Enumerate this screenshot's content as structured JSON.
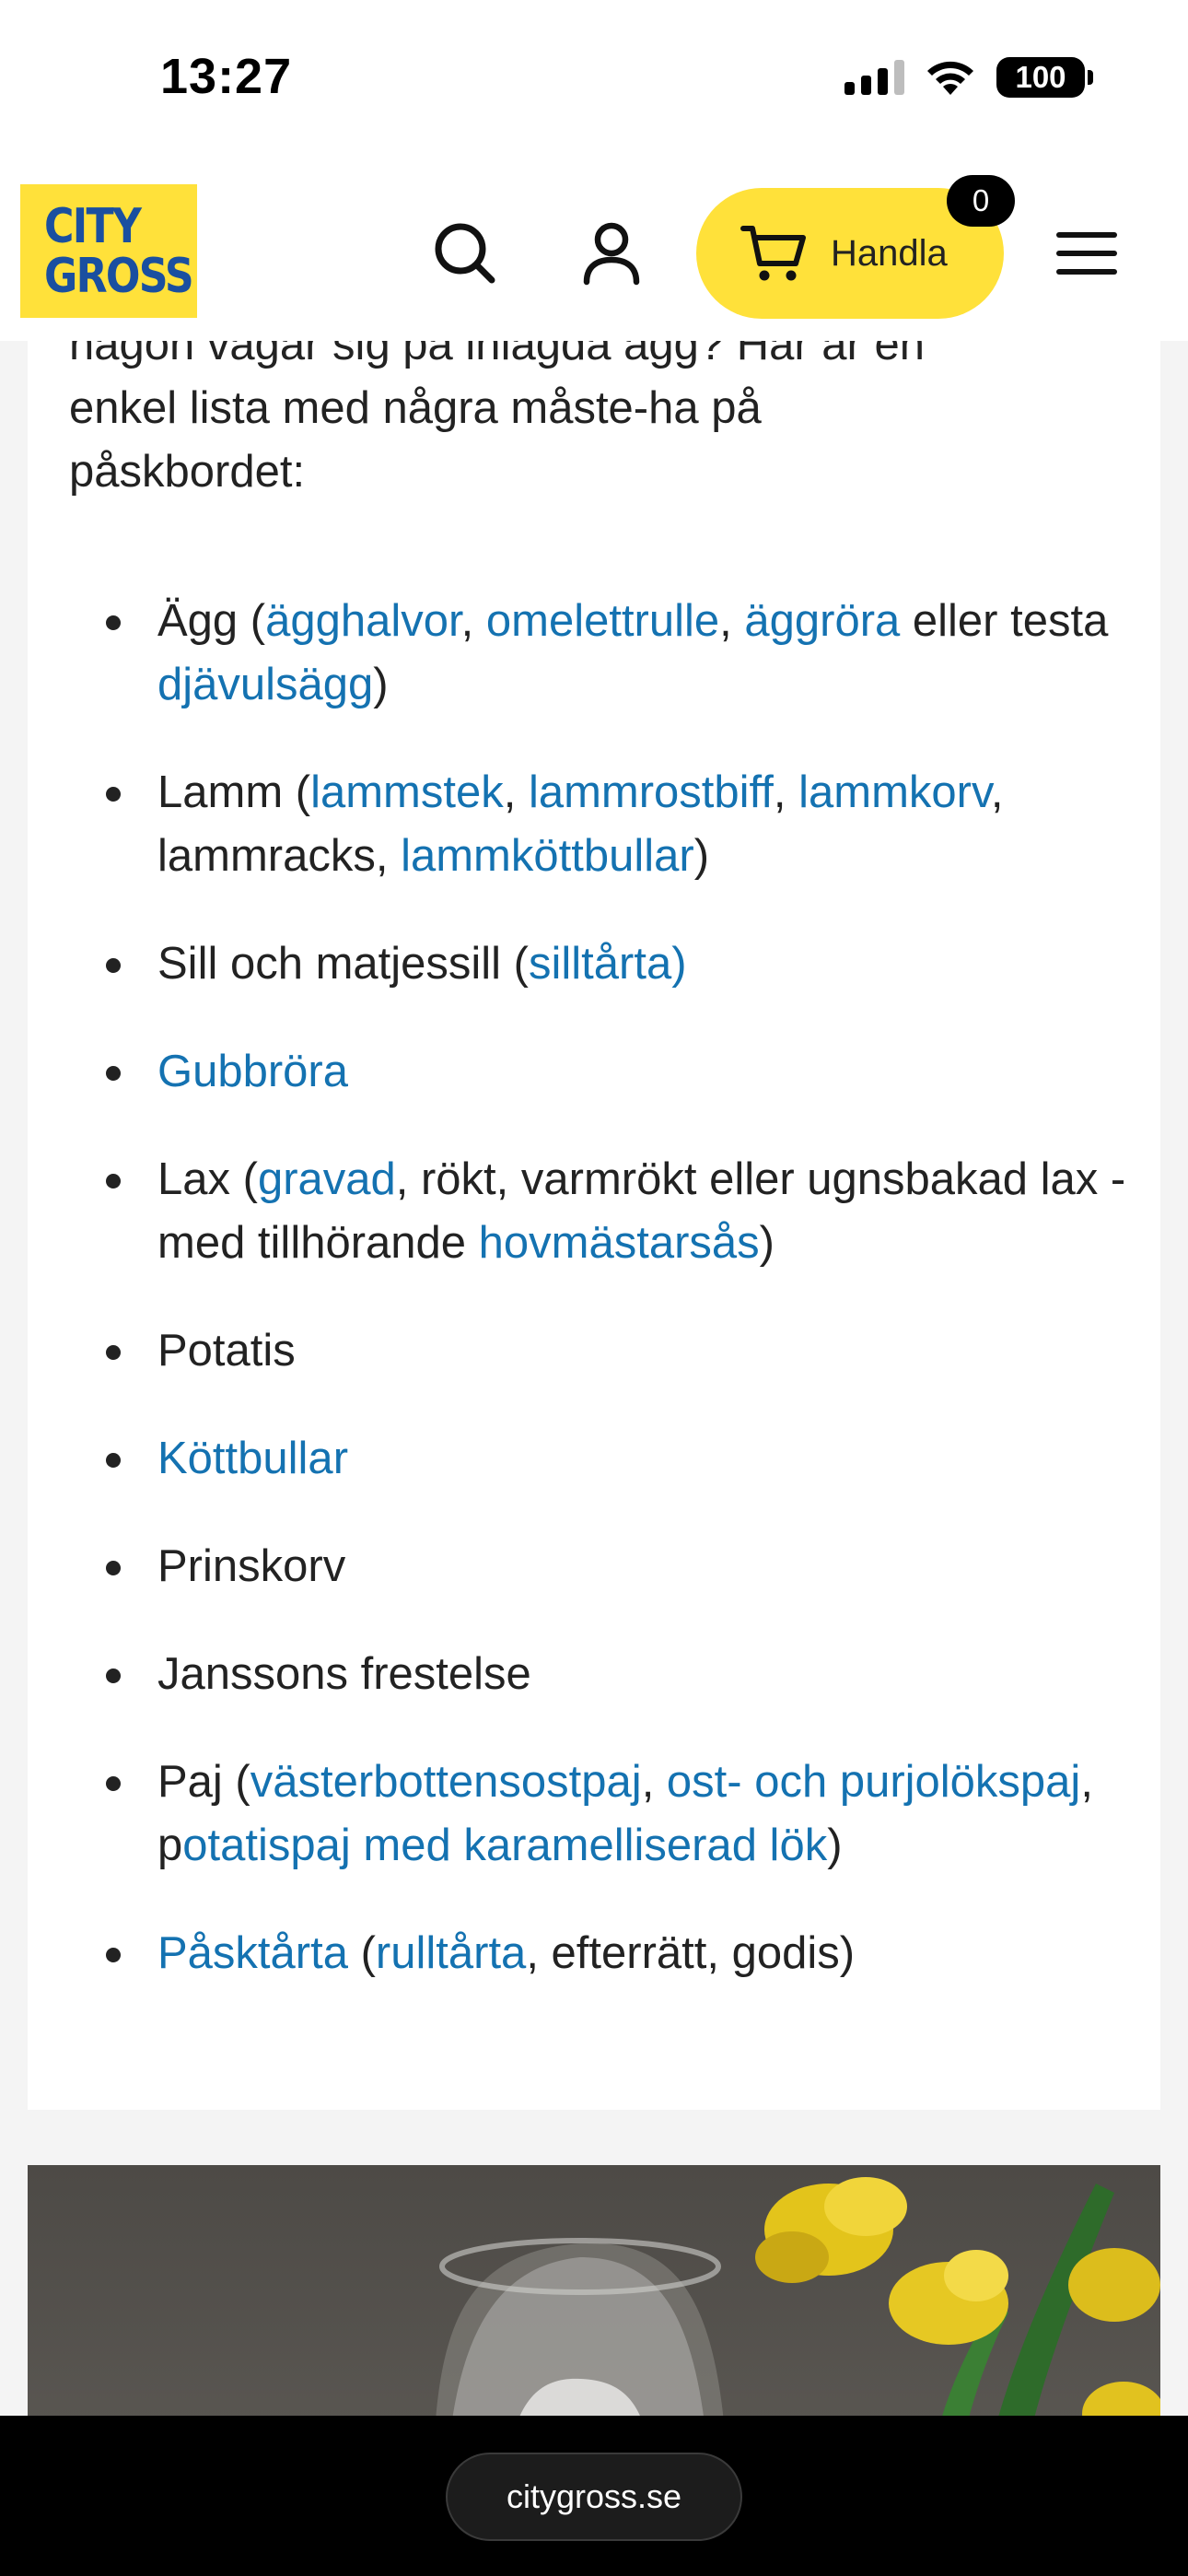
{
  "status_bar": {
    "time": "13:27",
    "battery": "100"
  },
  "header": {
    "logo_line1": "CITY",
    "logo_line2": "GROSS",
    "cart_label": "Handla",
    "cart_count": "0",
    "brand_yellow": "#ffe13a",
    "brand_blue": "#1a4fa0"
  },
  "article": {
    "intro_lines": [
      "någon vågar sig på inlagda ägg? Här är en",
      "enkel lista med några måste-ha på",
      "påskbordet:"
    ],
    "link_color": "#1472b1",
    "items": [
      {
        "segments": [
          {
            "t": "Ägg (",
            "link": false
          },
          {
            "t": "ägghalvor",
            "link": true
          },
          {
            "t": ", ",
            "link": false
          },
          {
            "t": "omelettrulle",
            "link": true
          },
          {
            "t": ", ",
            "link": false
          },
          {
            "t": "äggröra",
            "link": true
          },
          {
            "t": " eller testa ",
            "link": false
          },
          {
            "t": "djävulsägg",
            "link": true
          },
          {
            "t": ")",
            "link": false
          }
        ]
      },
      {
        "segments": [
          {
            "t": "Lamm (",
            "link": false
          },
          {
            "t": "lammstek",
            "link": true
          },
          {
            "t": ", ",
            "link": false
          },
          {
            "t": "lammrostbiff",
            "link": true
          },
          {
            "t": ", ",
            "link": false
          },
          {
            "t": "lammkorv",
            "link": true
          },
          {
            "t": ", lammracks, ",
            "link": false
          },
          {
            "t": "lammköttbullar",
            "link": true
          },
          {
            "t": ")",
            "link": false
          }
        ]
      },
      {
        "segments": [
          {
            "t": "Sill och matjessill (",
            "link": false
          },
          {
            "t": "silltårta)",
            "link": true
          }
        ]
      },
      {
        "segments": [
          {
            "t": "Gubbröra",
            "link": true
          }
        ]
      },
      {
        "segments": [
          {
            "t": "Lax (",
            "link": false
          },
          {
            "t": "gravad",
            "link": true
          },
          {
            "t": ", rökt, varmrökt eller ugnsbakad lax - med tillhörande ",
            "link": false
          },
          {
            "t": "hovmästarsås",
            "link": true
          },
          {
            "t": ")",
            "link": false
          }
        ]
      },
      {
        "segments": [
          {
            "t": "Potatis",
            "link": false
          }
        ]
      },
      {
        "segments": [
          {
            "t": "Köttbullar",
            "link": true
          }
        ]
      },
      {
        "segments": [
          {
            "t": "Prinskorv",
            "link": false
          }
        ]
      },
      {
        "segments": [
          {
            "t": "Janssons frestelse",
            "link": false
          }
        ]
      },
      {
        "segments": [
          {
            "t": "Paj (",
            "link": false
          },
          {
            "t": "västerbottensostpaj",
            "link": true
          },
          {
            "t": ", ",
            "link": false
          },
          {
            "t": "ost- och purjolökspaj",
            "link": true
          },
          {
            "t": ", p",
            "link": false
          },
          {
            "t": "otatispaj med karamelliserad lök",
            "link": true
          },
          {
            "t": ")",
            "link": false
          }
        ]
      },
      {
        "segments": [
          {
            "t": "Påsktårta",
            "link": true
          },
          {
            "t": " (",
            "link": false
          },
          {
            "t": "rulltårta",
            "link": true
          },
          {
            "t": ", efterrätt, godis)",
            "link": false
          }
        ]
      }
    ]
  },
  "browser": {
    "url": "citygross.se"
  }
}
